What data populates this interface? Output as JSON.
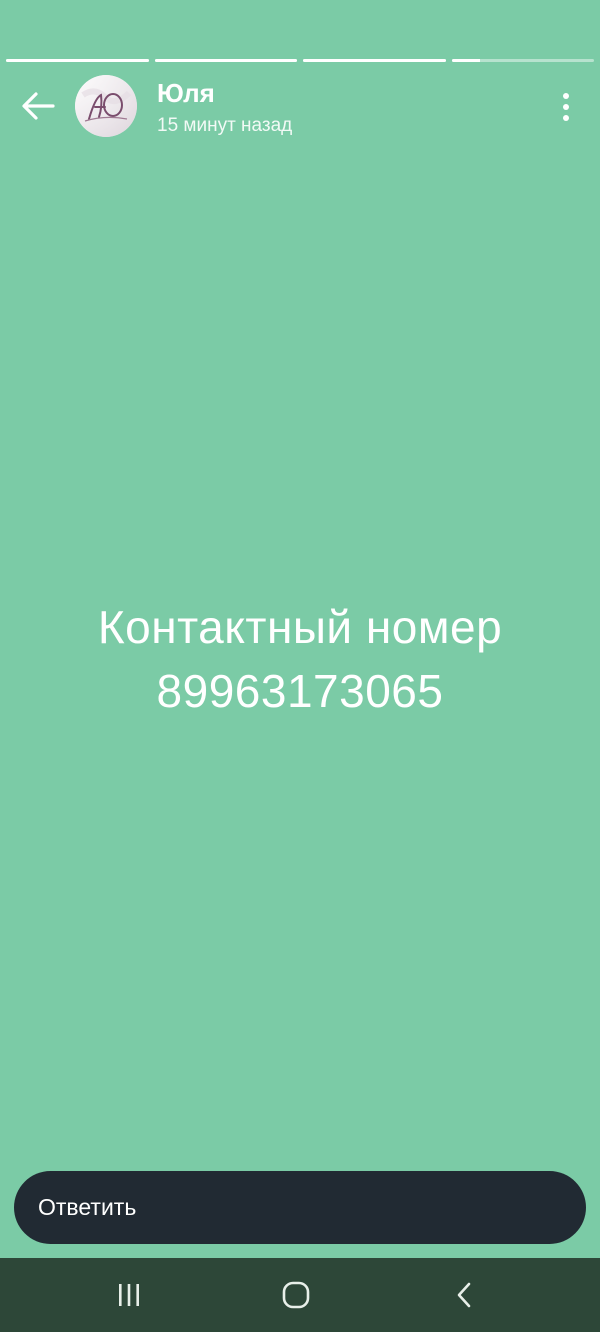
{
  "colors": {
    "background": "#7bcba6",
    "reply_bar": "#212a33",
    "nav_bar": "#2d4738",
    "text": "#ffffff"
  },
  "progress": {
    "segments": [
      1.0,
      1.0,
      1.0,
      0.2
    ]
  },
  "header": {
    "back_icon": "arrow-left-icon",
    "author_name": "Юля",
    "time_ago": "15 минут назад",
    "avatar_monogram": "ЮО",
    "menu_icon": "more-vertical-icon"
  },
  "story": {
    "line1": "Контактный номер",
    "line2": "89963173065"
  },
  "reply": {
    "placeholder": "Ответить"
  },
  "system_nav": {
    "recents_icon": "recent-apps-icon",
    "home_icon": "home-icon",
    "back_icon": "chevron-left-icon"
  }
}
